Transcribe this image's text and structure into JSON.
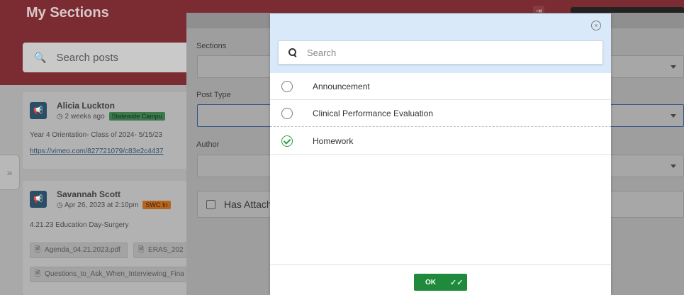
{
  "background": {
    "title": "My Sections",
    "search_placeholder": "Search posts",
    "expand_icon": "»",
    "posts": [
      {
        "author": "Alicia Luckton",
        "time": "2 weeks ago",
        "tag": "Statewide Campu",
        "text": "Year 4 Orientation- Class of 2024- 5/15/23",
        "link": "https://vimeo.com/827721079/c83e2c4437"
      },
      {
        "author": "Savannah Scott",
        "time": "Apr 26, 2023 at 2:10pm",
        "tag": "SWC In",
        "text": "4.21.23 Education Day-Surgery",
        "attachments": [
          "Agenda_04.21.2023.pdf",
          "ERAS_202",
          "Questions_to_Ask_When_Interviewing_Fina"
        ]
      }
    ]
  },
  "filter_panel": {
    "sections_label": "Sections",
    "post_type_label": "Post Type",
    "author_label": "Author",
    "has_attachments_label": "Has Attachr"
  },
  "modal": {
    "search_placeholder": "Search",
    "close_icon": "×",
    "options": [
      {
        "label": "Announcement",
        "selected": false
      },
      {
        "label": "Clinical Performance Evaluation",
        "selected": false
      },
      {
        "label": "Homework",
        "selected": true
      }
    ],
    "ok_label": "OK",
    "ok_icon": "✓✓"
  },
  "colors": {
    "header_brand": "#7a2c32",
    "modal_header": "#d9e9f9",
    "ok_green": "#1f8a3b",
    "check_green": "#2f9a44"
  }
}
